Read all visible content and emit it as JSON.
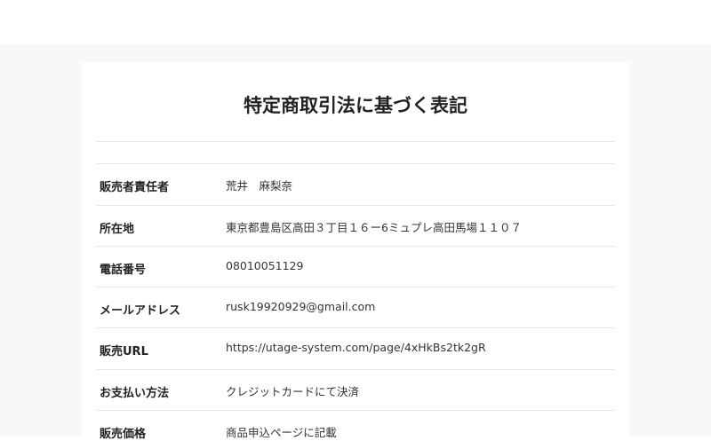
{
  "page": {
    "title": "特定商取引法に基づく表記"
  },
  "rows": [
    {
      "label": "販売者責任者",
      "value": "荒井　麻梨奈"
    },
    {
      "label": "所在地",
      "value": "東京都豊島区高田３丁目１６ー6ミュプレ高田馬場１１０７"
    },
    {
      "label": "電話番号",
      "value": "08010051129"
    },
    {
      "label": "メールアドレス",
      "value": "rusk19920929@gmail.com"
    },
    {
      "label": "販売URL",
      "value": "https://utage-system.com/page/4xHkBs2tk2gR"
    },
    {
      "label": "お支払い方法",
      "value": "クレジットカードにて決済"
    },
    {
      "label": "販売価格",
      "value": "商品申込ページに記載"
    }
  ]
}
